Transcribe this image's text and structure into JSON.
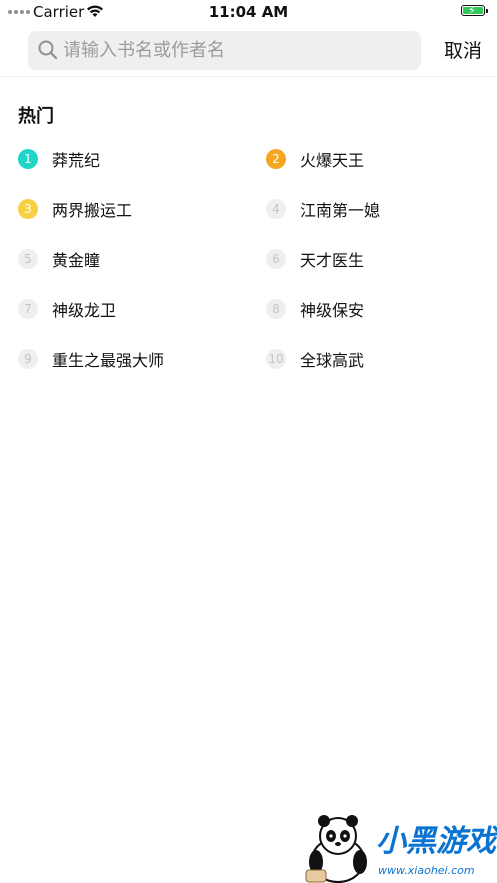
{
  "status_bar": {
    "carrier": "Carrier",
    "time": "11:04 AM"
  },
  "search": {
    "placeholder": "请输入书名或作者名",
    "value": "",
    "cancel_label": "取消"
  },
  "hot": {
    "title": "热门",
    "items": [
      {
        "rank": "1",
        "label": "莽荒纪"
      },
      {
        "rank": "2",
        "label": "火爆天王"
      },
      {
        "rank": "3",
        "label": "两界搬运工"
      },
      {
        "rank": "4",
        "label": "江南第一媳"
      },
      {
        "rank": "5",
        "label": "黄金瞳"
      },
      {
        "rank": "6",
        "label": "天才医生"
      },
      {
        "rank": "7",
        "label": "神级龙卫"
      },
      {
        "rank": "8",
        "label": "神级保安"
      },
      {
        "rank": "9",
        "label": "重生之最强大师"
      },
      {
        "rank": "10",
        "label": "全球高武"
      }
    ]
  },
  "watermark": {
    "name": "小黑游戏",
    "url": "www.xiaohei.com"
  },
  "colors": {
    "rank1": "#1fd5c8",
    "rank2": "#f5a623",
    "rank3": "#f7d142",
    "rank_default": "#efefef",
    "battery": "#34c759",
    "search_bg": "#efefef"
  }
}
